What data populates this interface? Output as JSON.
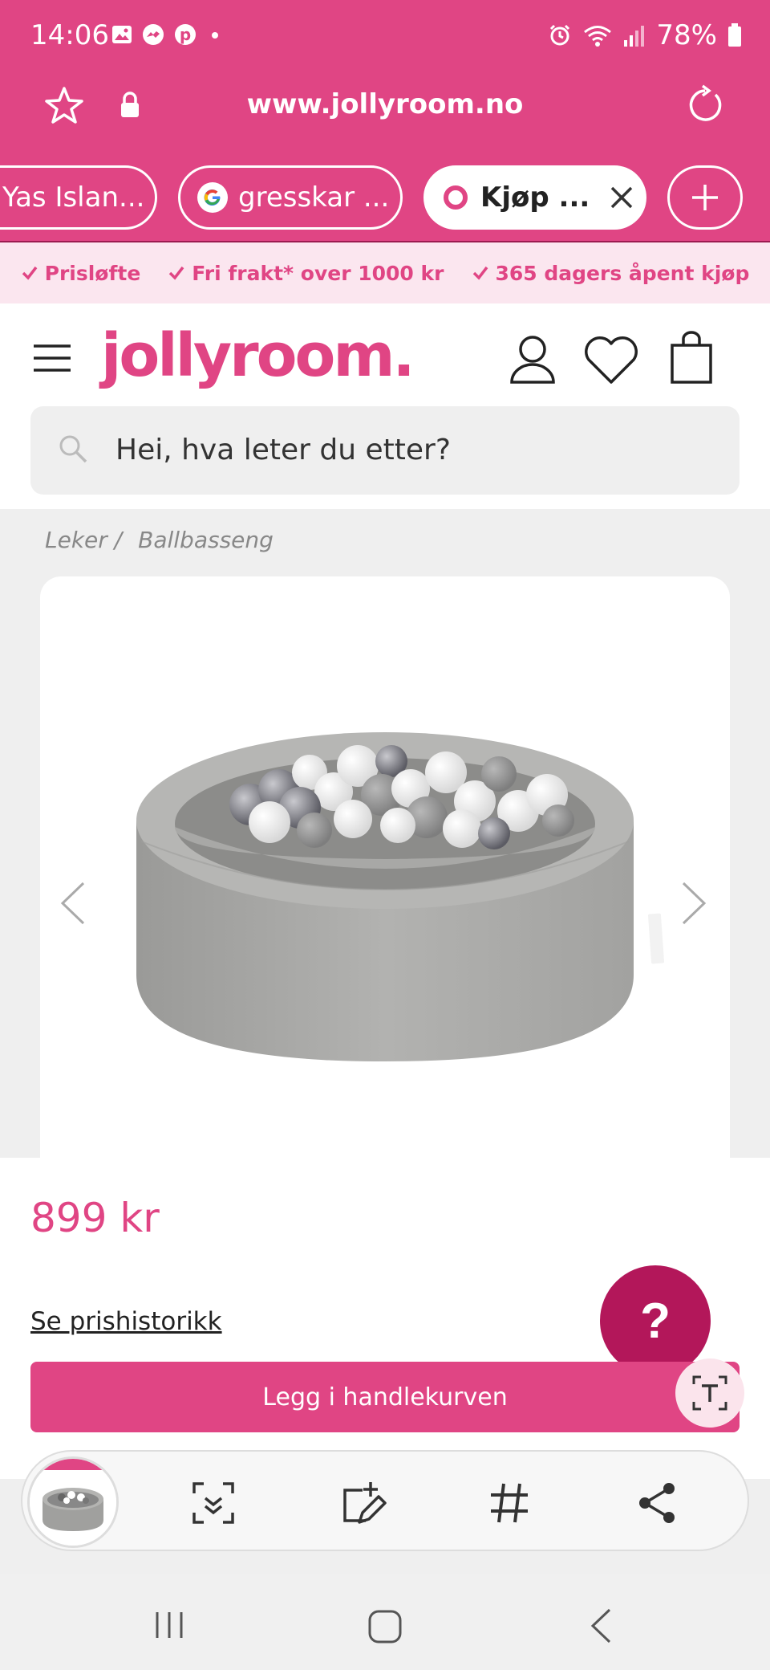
{
  "status_bar": {
    "time": "14:06",
    "battery": "78%"
  },
  "browser": {
    "url": "www.jollyroom.no",
    "tabs": [
      {
        "label": "Yas Islan..."
      },
      {
        "label": "gresskar ..."
      },
      {
        "label": "Kjøp ..."
      }
    ]
  },
  "promo": {
    "items": [
      "Prisløfte",
      "Fri frakt* over 1000 kr",
      "365 dagers åpent kjøp"
    ]
  },
  "header": {
    "logo": "jollyroom.",
    "search_placeholder": "Hei, hva leter du etter?"
  },
  "breadcrumb": {
    "items": [
      "Leker /",
      "Ballbasseng"
    ]
  },
  "product": {
    "price": "899 kr",
    "price_history_link": "Se prishistorikk",
    "add_to_cart": "Legg i handlekurven"
  },
  "colors": {
    "brand_pink": "#e04584",
    "help_button": "#b3175a",
    "promo_bg": "#fbe6ef"
  },
  "icons": {
    "toolbar": [
      "scan-icon",
      "draw-crop-icon",
      "hashtag-icon",
      "share-icon"
    ]
  }
}
